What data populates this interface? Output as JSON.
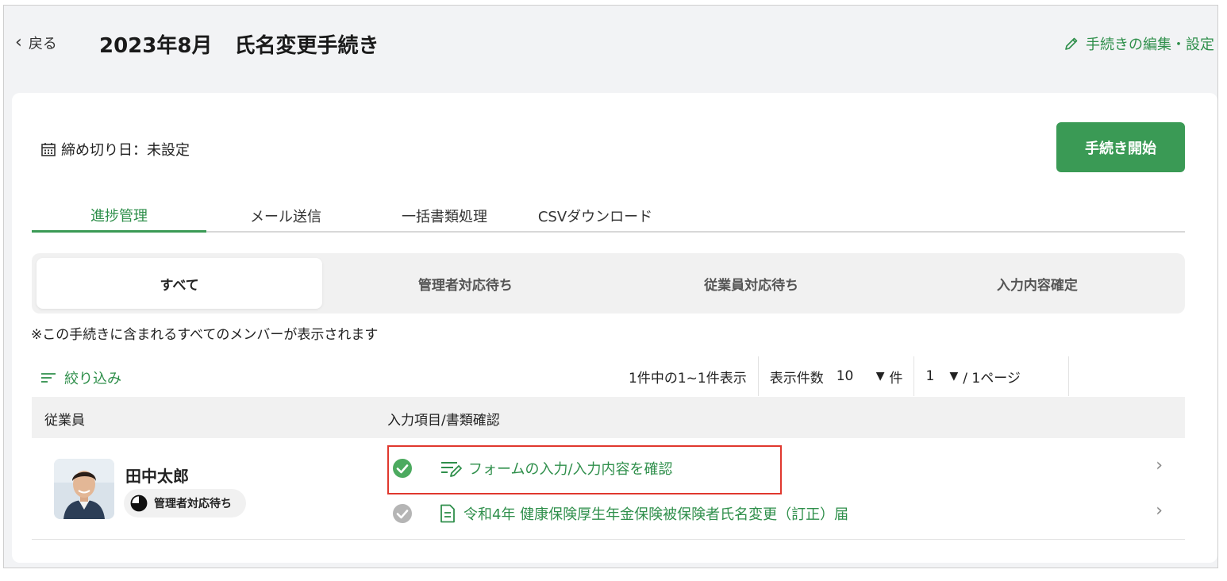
{
  "header": {
    "back_label": "戻る",
    "title_date": "2023年8月",
    "title_name": "氏名変更手続き",
    "edit_label": "手続きの編集・設定"
  },
  "deadline": {
    "label": "締め切り日：未設定"
  },
  "start_button": {
    "label": "手続き開始"
  },
  "tabs": [
    {
      "label": "進捗管理",
      "active": true
    },
    {
      "label": "メール送信",
      "active": false
    },
    {
      "label": "一括書類処理",
      "active": false
    },
    {
      "label": "CSVダウンロード",
      "active": false
    }
  ],
  "segments": [
    {
      "label": "すべて",
      "active": true
    },
    {
      "label": "管理者対応待ち",
      "active": false
    },
    {
      "label": "従業員対応待ち",
      "active": false
    },
    {
      "label": "入力内容確定",
      "active": false
    }
  ],
  "note": "※この手続きに含まれるすべてのメンバーが表示されます",
  "filter": {
    "label": "絞り込み"
  },
  "pager": {
    "summary": "1件中の1~1件表示",
    "per_page_label": "表示件数",
    "per_page_value": "10",
    "per_page_unit": "件",
    "page_value": "1",
    "page_total": "/ 1ページ"
  },
  "table": {
    "col_employee": "従業員",
    "col_items": "入力項目/書類確認"
  },
  "rows": [
    {
      "name": "田中太郎",
      "status": "管理者対応待ち",
      "items": [
        {
          "label": "フォームの入力/入力内容を確認",
          "done": true
        },
        {
          "label": "令和4年 健康保険厚生年金保険被保険者氏名変更（訂正）届",
          "done": false
        }
      ]
    }
  ],
  "colors": {
    "accent": "#3a9a55",
    "link": "#2f8f4b",
    "highlight": "#e0382e"
  }
}
